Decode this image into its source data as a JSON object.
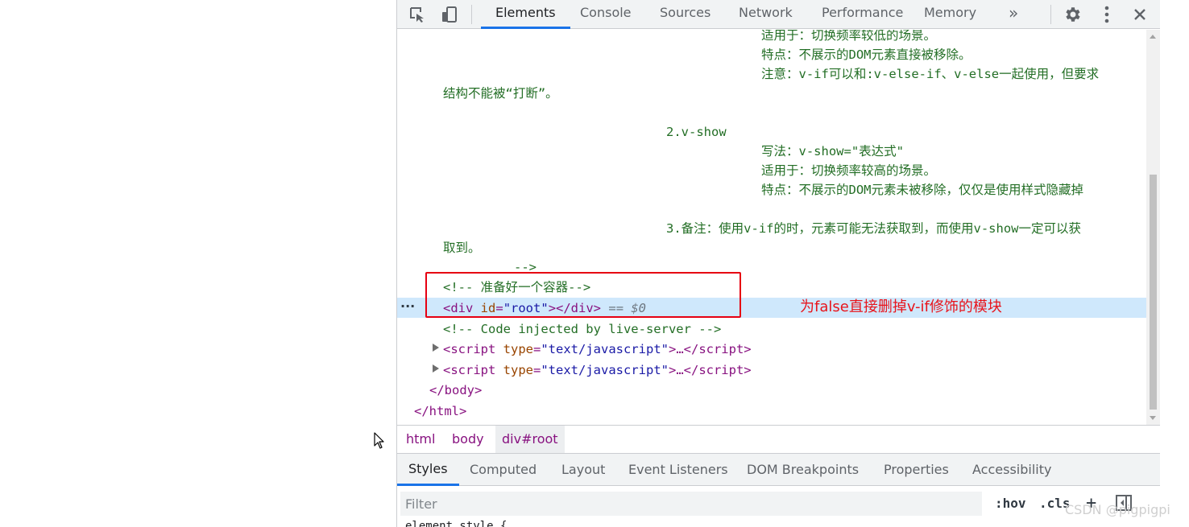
{
  "toolbar": {
    "tabs": [
      "Elements",
      "Console",
      "Sources",
      "Network",
      "Performance",
      "Memory"
    ],
    "more_label": "»"
  },
  "dom": {
    "text_lines": [
      "适用于：切换频率较低的场景。",
      "特点：不展示的DOM元素直接被移除。",
      "注意：v-if可以和:v-else-if、v-else一起使用，但要求",
      "结构不能被“打断”。",
      "2.v-show",
      "写法：v-show=\"表达式\"",
      "适用于：切换频率较高的场景。",
      "特点：不展示的DOM元素未被移除，仅仅是使用样式隐藏掉",
      "3.备注：使用v-if的时，元素可能无法获取到，而使用v-show一定可以获",
      "取到。",
      "-->"
    ],
    "comment_container": "<!-- 准备好一个容器-->",
    "div_open": "<div",
    "div_attr_name": "id",
    "div_attr_value": "\"root\"",
    "div_close": "></div>",
    "selected_hint": "== $0",
    "comment_live_server": "<!-- Code injected by live-server -->",
    "script_open": "<script",
    "script_attr_name": "type",
    "script_attr_value": "\"text/javascript\"",
    "script_mid": ">…</",
    "script_end_tag": "script>",
    "body_close": "</body>",
    "html_close": "</html>",
    "row_dots": "···"
  },
  "annotation": {
    "text": "为false直接删掉v-if修饰的模块",
    "color": "#e60012"
  },
  "breadcrumb": {
    "items": [
      "html",
      "body",
      "div#root"
    ]
  },
  "styles_tabs": [
    "Styles",
    "Computed",
    "Layout",
    "Event Listeners",
    "DOM Breakpoints",
    "Properties",
    "Accessibility"
  ],
  "filter": {
    "placeholder": "Filter",
    "hov": ":hov",
    "cls": ".cls",
    "plus": "+"
  },
  "watermark": "CSDN @pigpigpi"
}
